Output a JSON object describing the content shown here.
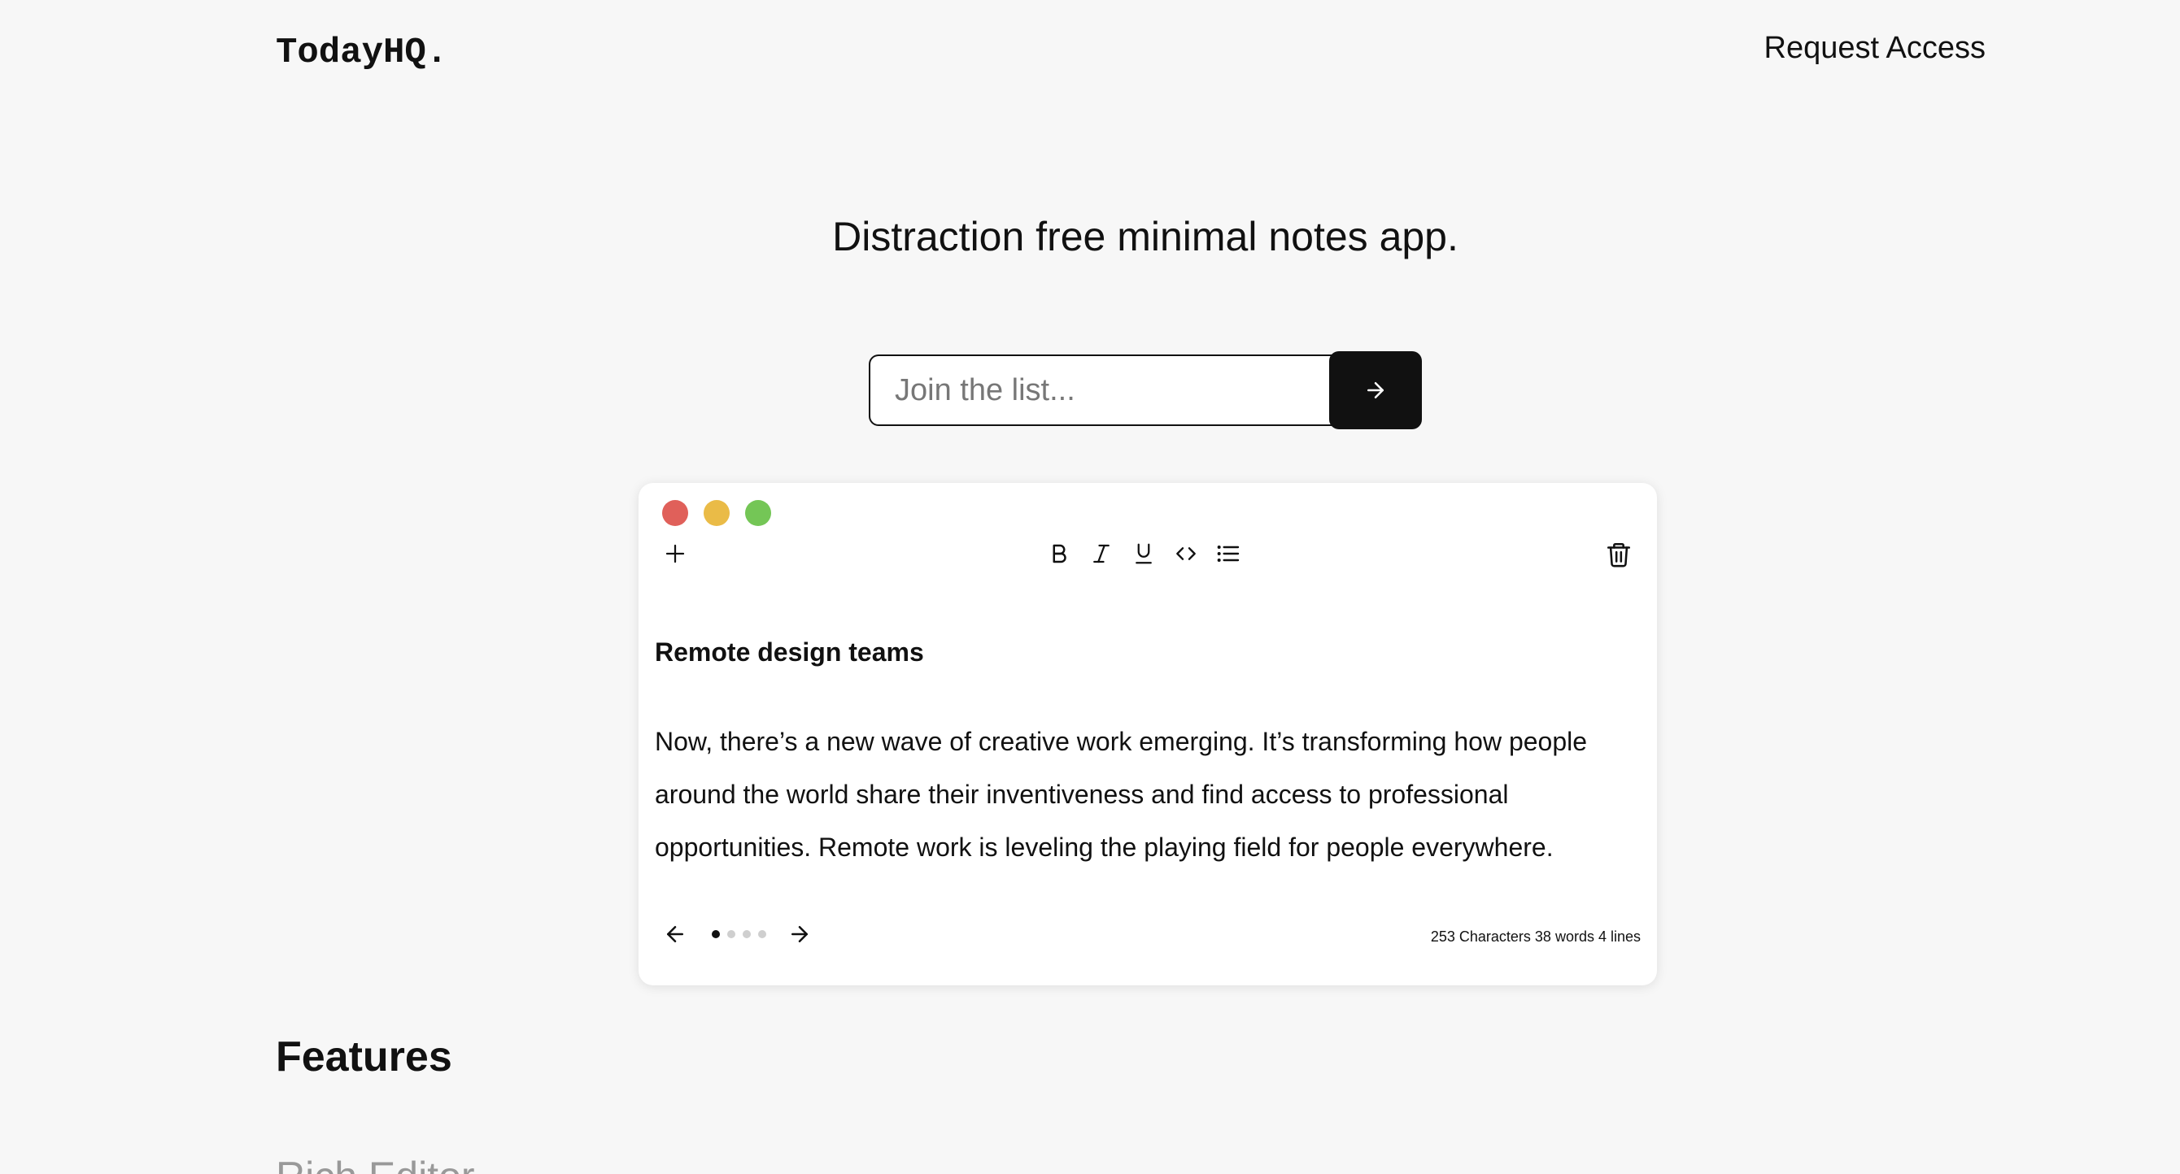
{
  "header": {
    "logo": "TodayHQ.",
    "request_access": "Request Access"
  },
  "hero": {
    "title": "Distraction free minimal notes app."
  },
  "signup": {
    "placeholder": "Join the list...",
    "submit_icon": "arrow-right-icon"
  },
  "editor": {
    "window_controls": [
      {
        "name": "close",
        "color": "#e0605a"
      },
      {
        "name": "minimize",
        "color": "#eabb47"
      },
      {
        "name": "maximize",
        "color": "#74c656"
      }
    ],
    "toolbar": {
      "new_note_icon": "plus-icon",
      "format_buttons": [
        "bold",
        "italic",
        "underline",
        "code",
        "list"
      ],
      "delete_icon": "trash-icon"
    },
    "note": {
      "title": "Remote design teams",
      "body": "Now, there’s a new wave of creative work emerging. It’s transforming how people around the world share their inventiveness and find access to professional opportunities. Remote work is leveling the playing field for people everywhere."
    },
    "pager": {
      "total_pages": 4,
      "current_page": 1
    },
    "stats": {
      "characters": "253 Characters",
      "words": "38 words",
      "lines": "4 lines"
    }
  },
  "features": {
    "heading": "Features",
    "items": [
      "Rich Editor"
    ]
  }
}
